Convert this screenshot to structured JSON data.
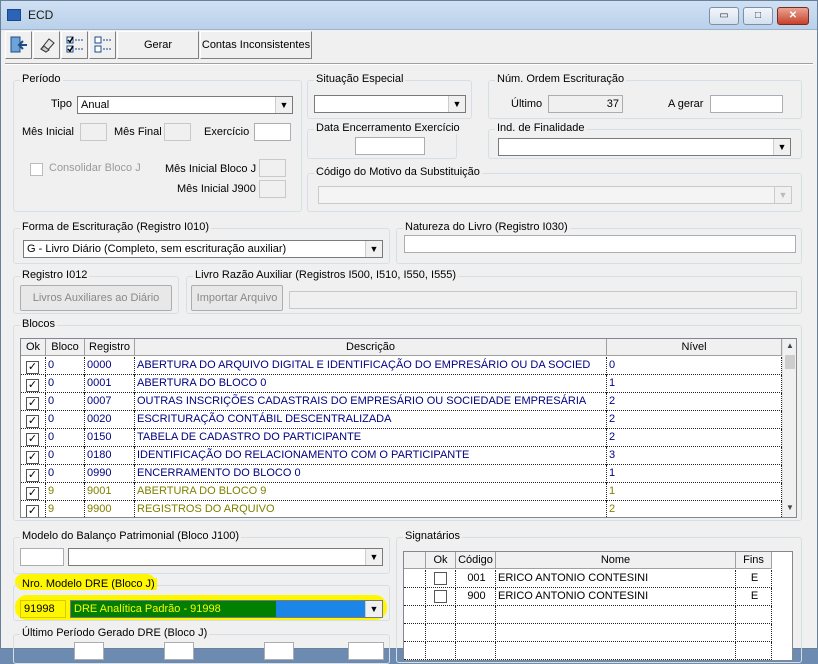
{
  "window": {
    "title": "ECD",
    "minimize": "▭",
    "maximize": "□",
    "close": "✕"
  },
  "toolbar": {
    "icons": [
      "exit-icon",
      "eraser-icon",
      "check-all-icon",
      "uncheck-all-icon"
    ],
    "gerar_label": "Gerar",
    "contas_label": "Contas Inconsistentes"
  },
  "periodo": {
    "legend": "Período",
    "tipo_label": "Tipo",
    "tipo_value": "Anual",
    "mes_inicial_label": "Mês Inicial",
    "mes_final_label": "Mês Final",
    "exercicio_label": "Exercício",
    "consolidar_label": "Consolidar Bloco J",
    "mes_inicial_bloco_j_label": "Mês Inicial Bloco J",
    "mes_inicial_j900_label": "Mês Inicial J900"
  },
  "situacao": {
    "legend": "Situação Especial",
    "value": ""
  },
  "num_ordem": {
    "legend": "Núm. Ordem Escrituração",
    "ultimo_label": "Último",
    "ultimo_value": "37",
    "a_gerar_label": "A gerar",
    "a_gerar_value": ""
  },
  "data_encerramento": {
    "legend": "Data Encerramento Exercício"
  },
  "ind_finalidade": {
    "legend": "Ind. de Finalidade",
    "value": ""
  },
  "codigo_motivo": {
    "legend": "Código do Motivo da Substituição",
    "value": ""
  },
  "forma": {
    "legend": "Forma de Escrituração (Registro I010)",
    "value": "G - Livro Diário (Completo, sem escrituração auxiliar)"
  },
  "natureza": {
    "legend": "Natureza do Livro (Registro I030)",
    "value": ""
  },
  "registro_i012": {
    "legend": "Registro I012",
    "button": "Livros Auxiliares ao Diário"
  },
  "livro_razao": {
    "legend": "Livro Razão Auxiliar (Registros I500, I510, I550, I555)",
    "button": "Importar Arquivo",
    "path": ""
  },
  "blocos": {
    "legend": "Blocos",
    "headers": [
      "Ok",
      "Bloco",
      "Registro",
      "Descrição",
      "Nível"
    ],
    "rows": [
      {
        "ok": "✓",
        "bloco": "0",
        "registro": "0000",
        "descricao": "ABERTURA DO ARQUIVO DIGITAL E IDENTIFICAÇÃO DO EMPRESÁRIO OU DA SOCIED",
        "nivel": "0"
      },
      {
        "ok": "✓",
        "bloco": "0",
        "registro": "0001",
        "descricao": "ABERTURA DO BLOCO 0",
        "nivel": "1"
      },
      {
        "ok": "✓",
        "bloco": "0",
        "registro": "0007",
        "descricao": "OUTRAS INSCRIÇÕES CADASTRAIS DO EMPRESÁRIO OU SOCIEDADE EMPRESÁRIA",
        "nivel": "2"
      },
      {
        "ok": "✓",
        "bloco": "0",
        "registro": "0020",
        "descricao": "ESCRITURAÇÃO CONTÁBIL DESCENTRALIZADA",
        "nivel": "2"
      },
      {
        "ok": "✓",
        "bloco": "0",
        "registro": "0150",
        "descricao": "TABELA DE CADASTRO DO PARTICIPANTE",
        "nivel": "2"
      },
      {
        "ok": "✓",
        "bloco": "0",
        "registro": "0180",
        "descricao": "IDENTIFICAÇÃO DO RELACIONAMENTO COM O PARTICIPANTE",
        "nivel": "3"
      },
      {
        "ok": "✓",
        "bloco": "0",
        "registro": "0990",
        "descricao": "ENCERRAMENTO DO BLOCO 0",
        "nivel": "1"
      },
      {
        "ok": "✓",
        "bloco": "9",
        "registro": "9001",
        "descricao": "ABERTURA DO BLOCO 9",
        "nivel": "1"
      },
      {
        "ok": "✓",
        "bloco": "9",
        "registro": "9900",
        "descricao": "REGISTROS DO ARQUIVO",
        "nivel": "2"
      }
    ]
  },
  "modelo_balanco": {
    "legend": "Modelo do Balanço Patrimonial (Bloco J100)",
    "code": "",
    "value": ""
  },
  "modelo_dre": {
    "legend": "Nro. Modelo DRE (Bloco J)",
    "code": "91998",
    "value": "DRE Analítica Padrão - 91998"
  },
  "ultimo_periodo": {
    "legend": "Último Período Gerado DRE (Bloco J)"
  },
  "signatarios": {
    "legend": "Signatários",
    "headers": [
      "Ok",
      "Código",
      "Nome",
      "Fins"
    ],
    "rows": [
      {
        "codigo": "001",
        "nome": "ERICO ANTONIO CONTESINI",
        "fins": "E"
      },
      {
        "codigo": "900",
        "nome": "ERICO ANTONIO CONTESINI",
        "fins": "E"
      }
    ]
  },
  "colors": {
    "blue_row": "#000080",
    "olive_row": "#808000",
    "highlight": "#fff700",
    "selection_green": "#008000",
    "selection_blue": "#1c86e8"
  }
}
